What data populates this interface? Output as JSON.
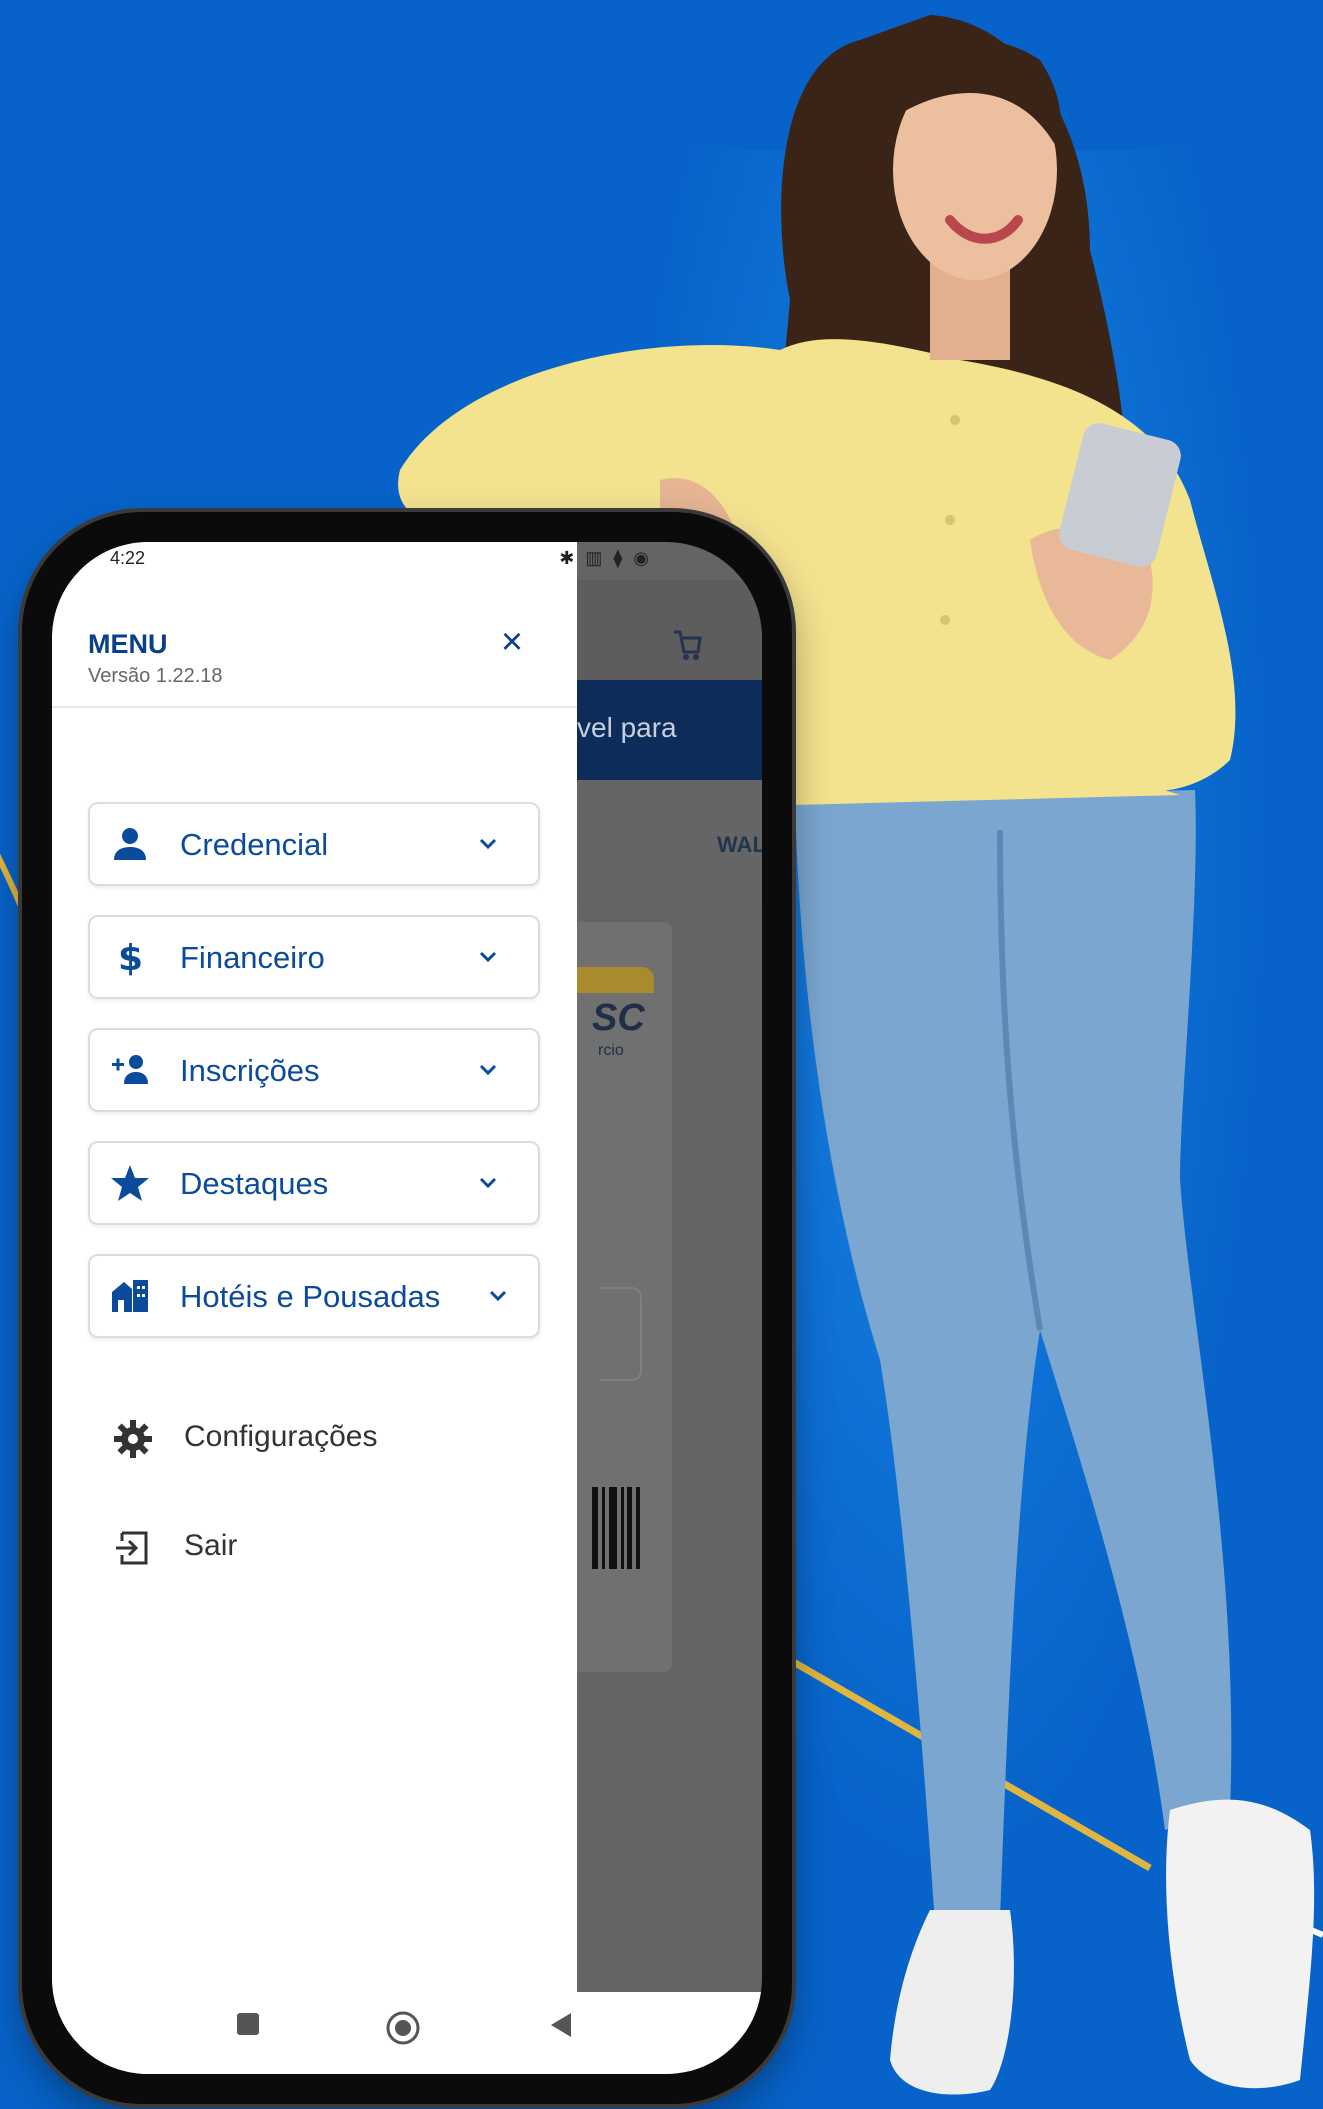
{
  "status_bar": {
    "time": "4:22",
    "icons": "✱ ▥ ⧫ ◉"
  },
  "drawer": {
    "title": "MENU",
    "version": "Versão 1.22.18",
    "close_label": "×",
    "items": [
      {
        "label": "Credencial",
        "icon": "person-icon"
      },
      {
        "label": "Financeiro",
        "icon": "dollar-icon"
      },
      {
        "label": "Inscrições",
        "icon": "add-person-icon"
      },
      {
        "label": "Destaques",
        "icon": "star-icon"
      },
      {
        "label": "Hotéis e Pousadas",
        "icon": "hotel-icon"
      }
    ],
    "settings_label": "Configurações",
    "logout_label": "Sair"
  },
  "background_app": {
    "banner_text": "vel para",
    "tab_label": "WAL",
    "card_logo": "SC",
    "card_logo_sub": "rcio"
  },
  "colors": {
    "brand_blue": "#0b4b9c",
    "background": "#0763c9",
    "accent_gold": "#e0b640"
  }
}
